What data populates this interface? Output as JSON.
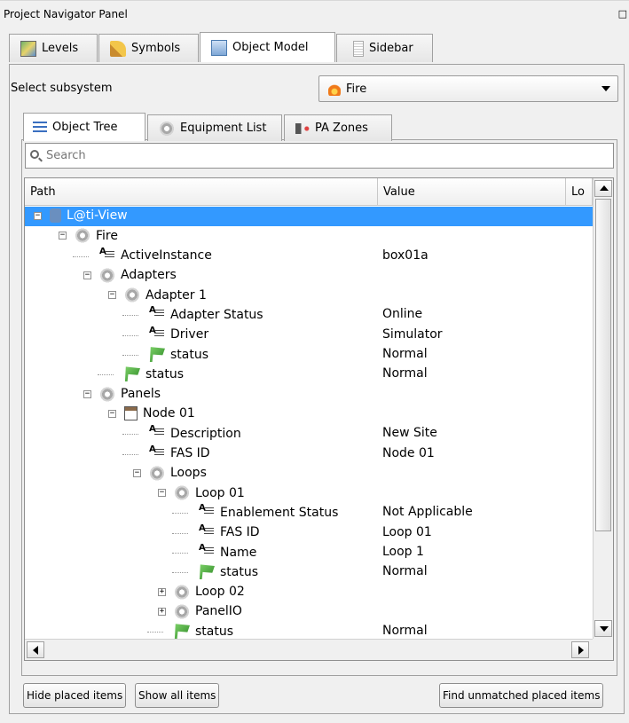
{
  "panel": {
    "title": "Project Navigator Panel"
  },
  "top_tabs": [
    {
      "label": "Levels",
      "icon": "levels-map-icon"
    },
    {
      "label": "Symbols",
      "icon": "symbols-brush-icon"
    },
    {
      "label": "Object Model",
      "icon": "object-model-icon",
      "active": true
    },
    {
      "label": "Sidebar",
      "icon": "sidebar-icon"
    }
  ],
  "subsystem": {
    "label": "Select subsystem",
    "selected": "Fire",
    "icon": "fire-icon"
  },
  "inner_tabs": [
    {
      "label": "Object Tree",
      "icon": "tree-list-icon",
      "active": true
    },
    {
      "label": "Equipment List",
      "icon": "gear-icon"
    },
    {
      "label": "PA Zones",
      "icon": "speaker-icon"
    }
  ],
  "search": {
    "placeholder": "Search"
  },
  "columns": {
    "path": "Path",
    "value": "Value",
    "location": "Lo"
  },
  "tree_rows": [
    {
      "label": "L@ti-View",
      "value": "",
      "level": 0,
      "icon": "root",
      "exp": "-",
      "selected": true
    },
    {
      "label": "Fire",
      "value": "",
      "level": 1,
      "icon": "gear",
      "exp": "-"
    },
    {
      "label": "ActiveInstance",
      "value": "box01a",
      "level": 2,
      "icon": "attr"
    },
    {
      "label": "Adapters",
      "value": "",
      "level": 2,
      "icon": "gear",
      "exp": "-"
    },
    {
      "label": "Adapter 1",
      "value": "",
      "level": 3,
      "icon": "gear",
      "exp": "-"
    },
    {
      "label": "Adapter Status",
      "value": "Online",
      "level": 4,
      "icon": "attr"
    },
    {
      "label": "Driver",
      "value": "Simulator",
      "level": 4,
      "icon": "attr"
    },
    {
      "label": "status",
      "value": "Normal",
      "level": 4,
      "icon": "flag"
    },
    {
      "label": "status",
      "value": "Normal",
      "level": 3,
      "icon": "flag"
    },
    {
      "label": "Panels",
      "value": "",
      "level": 2,
      "icon": "gear",
      "exp": "-"
    },
    {
      "label": "Node 01",
      "value": "",
      "level": 3,
      "icon": "nodebox",
      "exp": "-"
    },
    {
      "label": "Description",
      "value": "New Site",
      "level": 4,
      "icon": "attr"
    },
    {
      "label": "FAS ID",
      "value": "Node 01",
      "level": 4,
      "icon": "attr"
    },
    {
      "label": "Loops",
      "value": "",
      "level": 4,
      "icon": "gear",
      "exp": "-"
    },
    {
      "label": "Loop 01",
      "value": "",
      "level": 5,
      "icon": "gear",
      "exp": "-"
    },
    {
      "label": "Enablement Status",
      "value": "Not Applicable",
      "level": 6,
      "icon": "attr"
    },
    {
      "label": "FAS ID",
      "value": "Loop 01",
      "level": 6,
      "icon": "attr"
    },
    {
      "label": "Name",
      "value": "Loop 1",
      "level": 6,
      "icon": "attr"
    },
    {
      "label": "status",
      "value": "Normal",
      "level": 6,
      "icon": "flag"
    },
    {
      "label": "Loop 02",
      "value": "",
      "level": 5,
      "icon": "gear",
      "exp": "+"
    },
    {
      "label": "PanelIO",
      "value": "",
      "level": 5,
      "icon": "gear",
      "exp": "+"
    },
    {
      "label": "status",
      "value": "Normal",
      "level": 5,
      "icon": "flag"
    }
  ],
  "buttons": {
    "hide_placed": "Hide placed items",
    "show_all": "Show all items",
    "find_unmatched": "Find unmatched placed items"
  }
}
